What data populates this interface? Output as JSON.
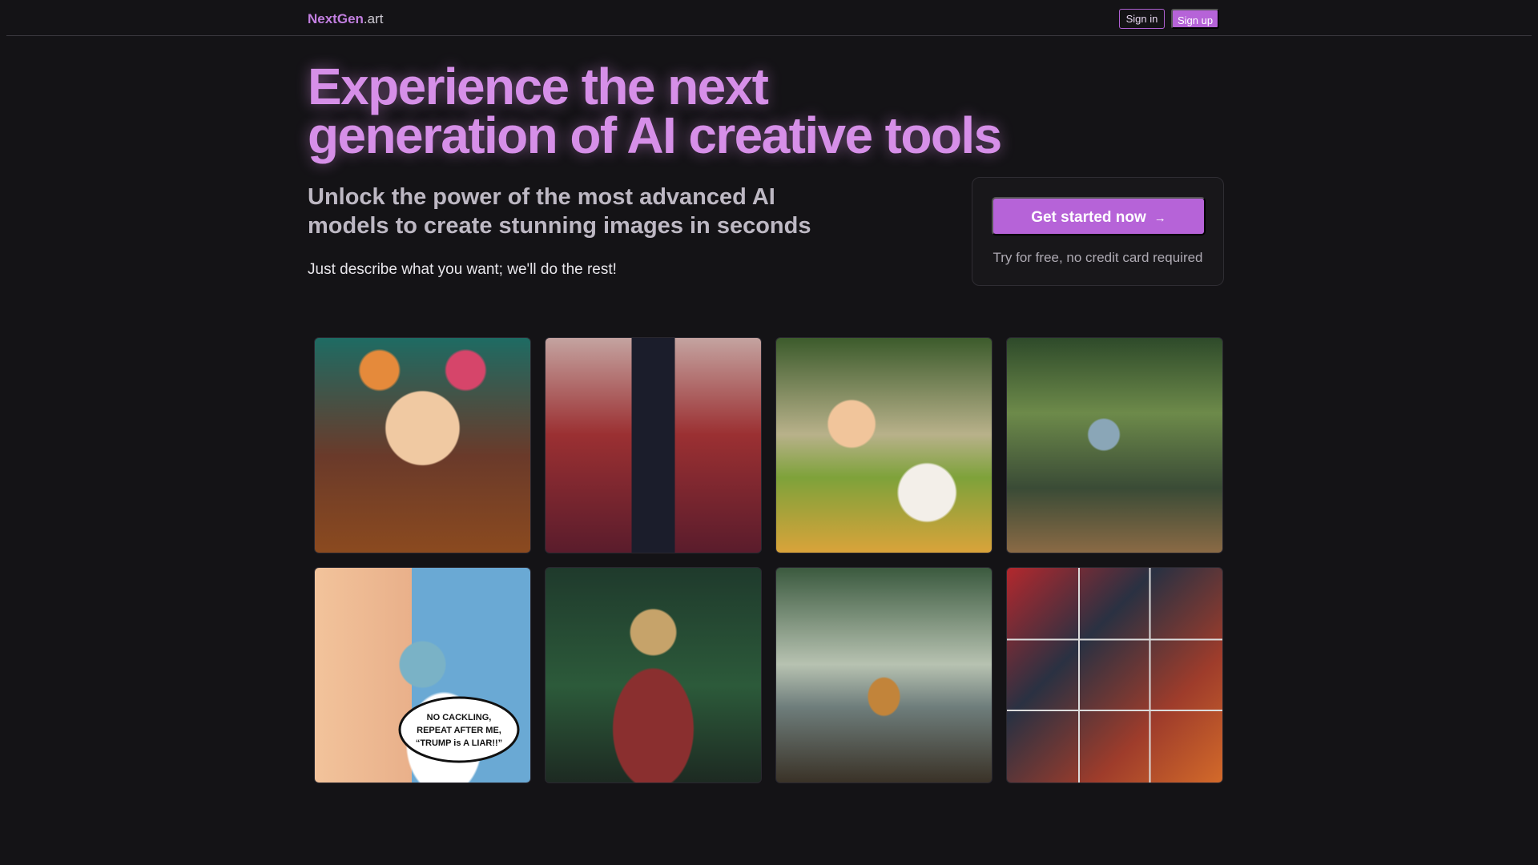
{
  "brand": {
    "name": "NextGen",
    "suffix": ".art"
  },
  "nav": {
    "signin_label": "Sign in",
    "signup_label": "Sign up"
  },
  "hero": {
    "headline_line1": "Experience the next",
    "headline_line2": "generation of AI creative tools",
    "subhead_line1": "Unlock the power of the most advanced AI",
    "subhead_line2": "models to create stunning images in seconds",
    "tagline": "Just describe what you want; we'll do the rest!"
  },
  "cta": {
    "button_label": "Get started now",
    "arrow": "→",
    "note": "Try for free, no credit card required"
  },
  "gallery": {
    "images": [
      {
        "name": "anime-girl-flowers"
      },
      {
        "name": "man-suit-crowd"
      },
      {
        "name": "girl-puppy-meadow"
      },
      {
        "name": "boy-dog-forest-stream"
      },
      {
        "name": "political-cartoon"
      },
      {
        "name": "meditating-deity-forest"
      },
      {
        "name": "dog-river-forest"
      },
      {
        "name": "superhero-comic-grid"
      }
    ],
    "comic_bubble_text": "NO CACKLING, REPEAT AFTER ME, “TRUMP is A LIAR!!”"
  },
  "colors": {
    "background": "#141316",
    "accent": "#b663d8",
    "headline": "#d68fe8"
  }
}
